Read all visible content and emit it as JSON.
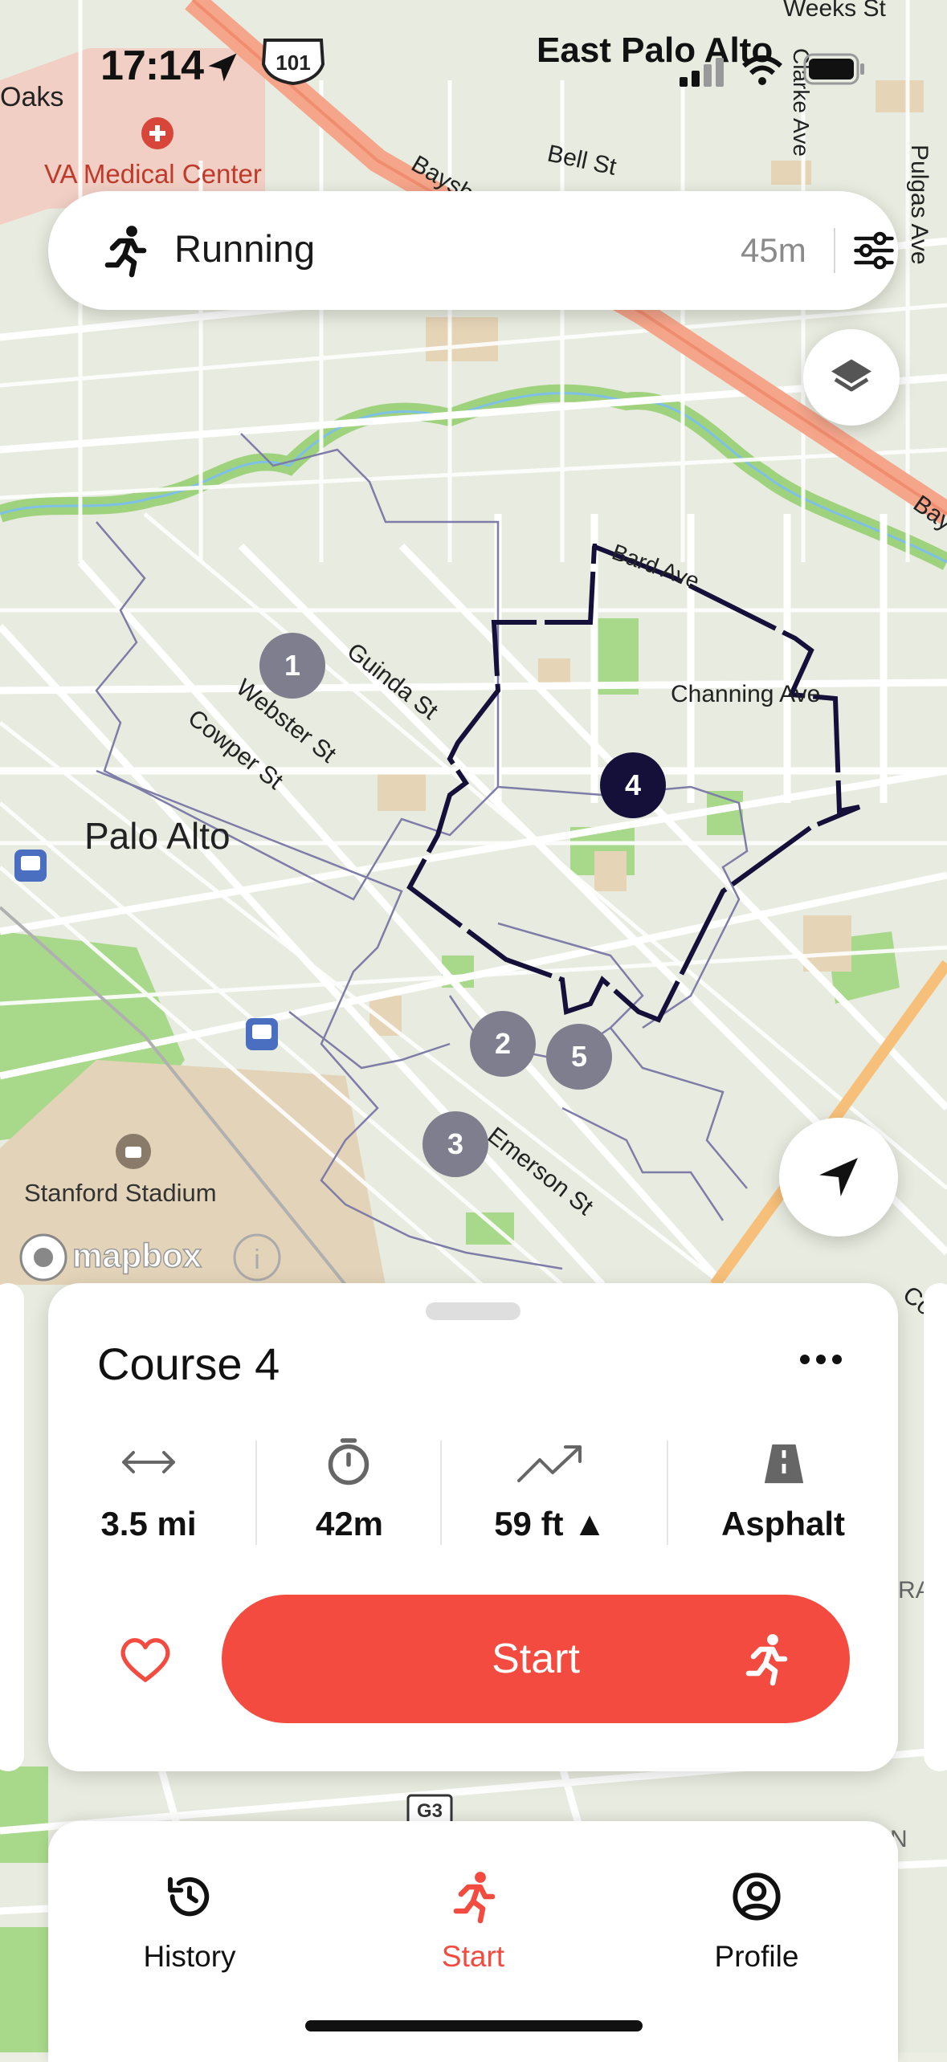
{
  "status_bar": {
    "time": "17:14",
    "carrier_label": "East Palo Alto"
  },
  "map": {
    "labels": {
      "oaks": "Oaks",
      "va_medical": "VA Medical Center",
      "bell_st": "Bell St",
      "bayshore": "Baysh",
      "weeks_st": "Weeks St",
      "clarke_ave": "Clarke Ave",
      "pulgas_ave": "Pulgas Ave",
      "bay_edge": "Bay",
      "bard_ave": "Bard Ave",
      "channing_ave": "Channing Ave",
      "guinda_st": "Guinda St",
      "webster_st": "Webster St",
      "cowper_st": "Cowper St",
      "palo_alto": "Palo Alto",
      "emerson_st": "Emerson St",
      "stanford_stadium": "Stanford Stadium",
      "shield_101": "101",
      "shield_g3": "G3",
      "co_edge": "Co",
      "ra_edge": "RA",
      "n_edge": "N",
      "mapbox": "mapbox"
    },
    "markers": [
      {
        "label": "1",
        "active": false
      },
      {
        "label": "2",
        "active": false
      },
      {
        "label": "3",
        "active": false
      },
      {
        "label": "4",
        "active": true
      },
      {
        "label": "5",
        "active": false
      }
    ]
  },
  "activity_bar": {
    "activity": "Running",
    "duration": "45m",
    "icon": "runner-icon",
    "filter_icon": "sliders-icon"
  },
  "course": {
    "title": "Course 4",
    "stats": [
      {
        "icon": "distance-arrows-icon",
        "value": "3.5 mi"
      },
      {
        "icon": "stopwatch-icon",
        "value": "42m"
      },
      {
        "icon": "elevation-trend-icon",
        "value": "59 ft ▲"
      },
      {
        "icon": "road-icon",
        "value": "Asphalt"
      }
    ],
    "start_label": "Start"
  },
  "tabs": [
    {
      "label": "History",
      "icon": "history-icon",
      "active": false
    },
    {
      "label": "Start",
      "icon": "runner-icon",
      "active": true
    },
    {
      "label": "Profile",
      "icon": "profile-icon",
      "active": false
    }
  ],
  "colors": {
    "accent": "#f34b3f",
    "route": "#14103a",
    "marker": "#7e7e8e",
    "park": "#a8d98a"
  }
}
